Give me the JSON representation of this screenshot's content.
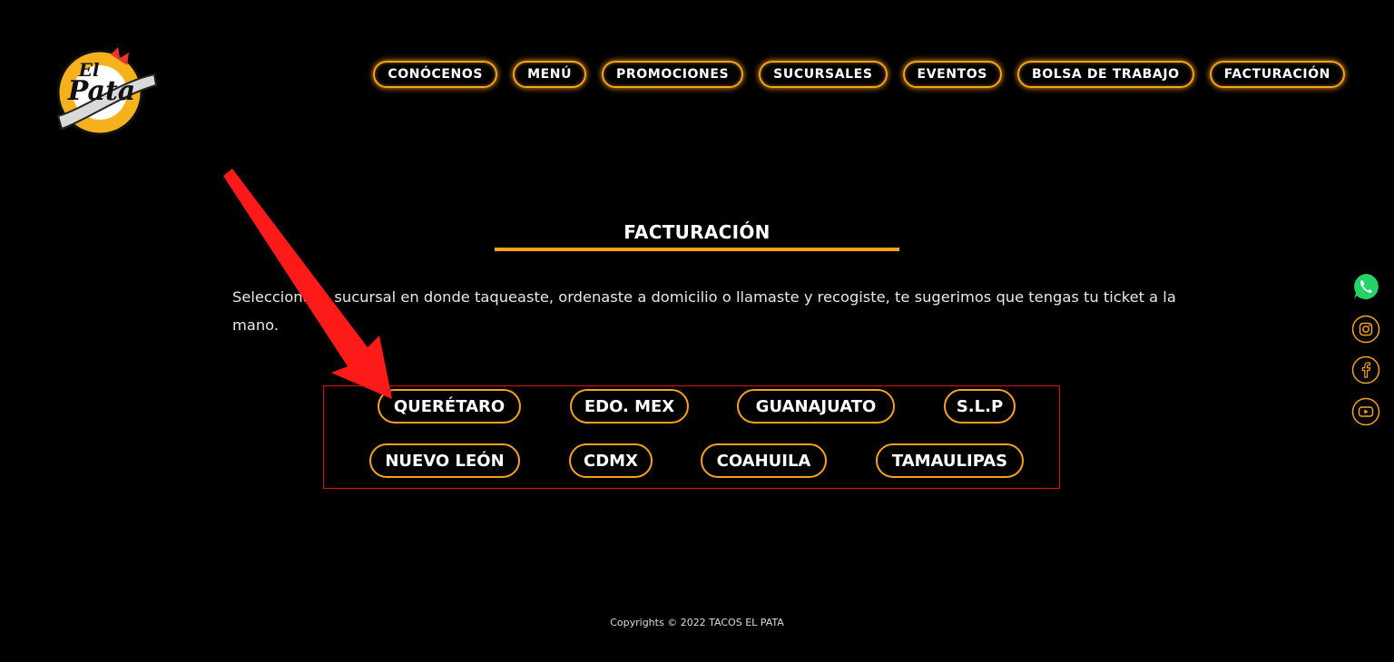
{
  "brand": {
    "logo_alt": "Tacos El Pata México"
  },
  "nav": {
    "items": [
      {
        "label": "CONÓCENOS"
      },
      {
        "label": "MENÚ"
      },
      {
        "label": "PROMOCIONES"
      },
      {
        "label": "SUCURSALES"
      },
      {
        "label": "EVENTOS"
      },
      {
        "label": "BOLSA DE TRABAJO"
      },
      {
        "label": "FACTURACIÓN"
      }
    ]
  },
  "main": {
    "title": "FACTURACIÓN",
    "intro": "Selecciona la sucursal en donde taqueaste, ordenaste a domicilio o llamaste y recogiste, te sugerimos que tengas tu ticket a la mano.",
    "branches": [
      {
        "label": "QUERÉTARO"
      },
      {
        "label": "EDO. MEX"
      },
      {
        "label": "GUANAJUATO"
      },
      {
        "label": "S.L.P"
      },
      {
        "label": "NUEVO LEÓN"
      },
      {
        "label": "CDMX"
      },
      {
        "label": "COAHUILA"
      },
      {
        "label": "TAMAULIPAS"
      }
    ]
  },
  "social": {
    "items": [
      {
        "icon": "whatsapp-icon"
      },
      {
        "icon": "instagram-icon"
      },
      {
        "icon": "facebook-icon"
      },
      {
        "icon": "youtube-icon"
      }
    ]
  },
  "footer": {
    "copyright": "Copyrights © 2022 TACOS EL PATA"
  },
  "colors": {
    "accent": "#f7a21b",
    "annotation": "#ff1a1a",
    "whatsapp": "#25d366",
    "background": "#000000"
  }
}
